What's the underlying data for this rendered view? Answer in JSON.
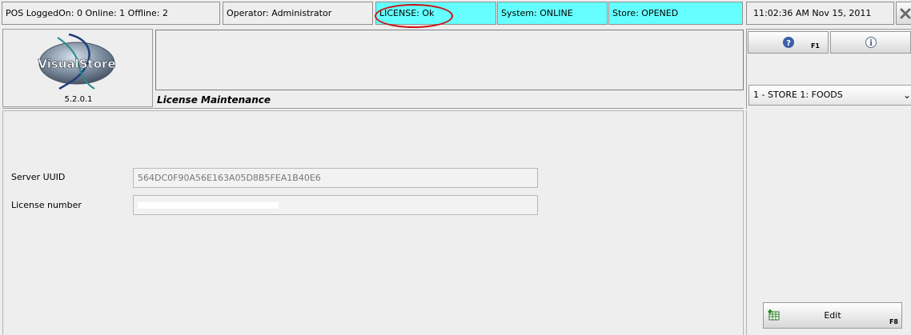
{
  "status_bar": {
    "pos_status": "POS LoggedOn: 0  Online: 1  Offline: 2",
    "operator": "Operator:  Administrator",
    "license": "LICENSE: Ok",
    "system": "System: ONLINE",
    "store": "Store: OPENED",
    "datetime": "11:02:36 AM   Nov 15, 2011",
    "close_icon": "close-icon"
  },
  "header": {
    "logo_text": "VisualStore",
    "version": "5.2.0.1",
    "page_title": "License Maintenance"
  },
  "right_panel": {
    "help_key": "F1",
    "help_icon": "help-icon",
    "info_icon": "info-icon",
    "store_selector": "1 - STORE 1: FOODS"
  },
  "form": {
    "server_uuid_label": "Server UUID",
    "server_uuid_value": "564DC0F90A56E163A05D8B5FEA1B40E6",
    "license_number_label": "License number",
    "license_number_value": ""
  },
  "actions": {
    "edit_label": "Edit",
    "edit_key": "F8",
    "edit_icon": "edit-grid-icon"
  },
  "colors": {
    "status_highlight": "#66ffff",
    "annotation_circle": "#cc1111",
    "background": "#eeeeee"
  }
}
